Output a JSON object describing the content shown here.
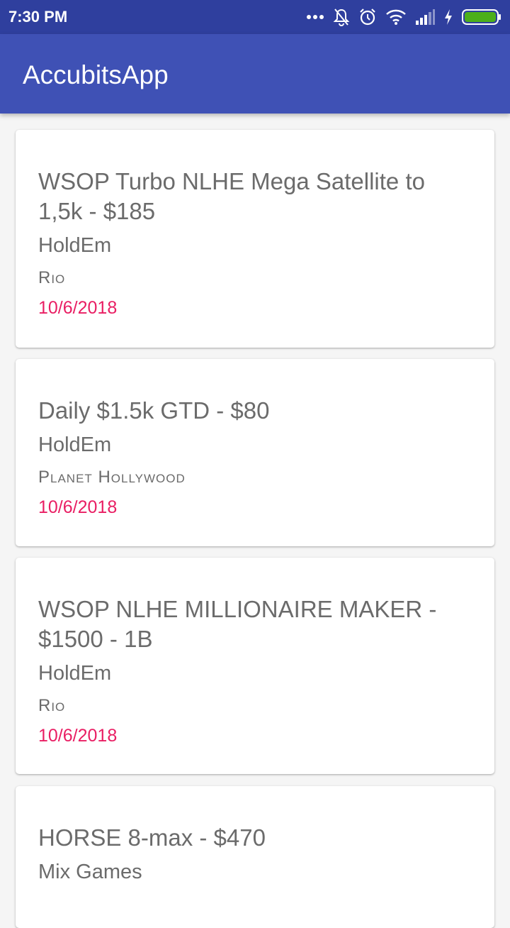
{
  "status_bar": {
    "time": "7:30 PM",
    "icons": [
      "more-dots-icon",
      "notifications-off-icon",
      "alarm-icon",
      "wifi-icon",
      "signal-icon",
      "charging-icon",
      "battery-icon"
    ],
    "battery_color": "#4caf1a"
  },
  "app_bar": {
    "title": "AccubitsApp",
    "color": "#3f51b5"
  },
  "accent_color": "#e91e63",
  "events": [
    {
      "title": "WSOP Turbo NLHE Mega Satellite to 1,5k - $185",
      "game": "HoldEm",
      "venue": "Rio",
      "date": "10/6/2018"
    },
    {
      "title": "Daily $1.5k GTD - $80",
      "game": "HoldEm",
      "venue": "Planet Hollywood",
      "date": "10/6/2018"
    },
    {
      "title": "WSOP NLHE MILLIONAIRE MAKER - $1500 - 1B",
      "game": "HoldEm",
      "venue": "Rio",
      "date": "10/6/2018"
    },
    {
      "title": "HORSE 8-max - $470",
      "game": "Mix Games",
      "venue": "",
      "date": ""
    }
  ]
}
